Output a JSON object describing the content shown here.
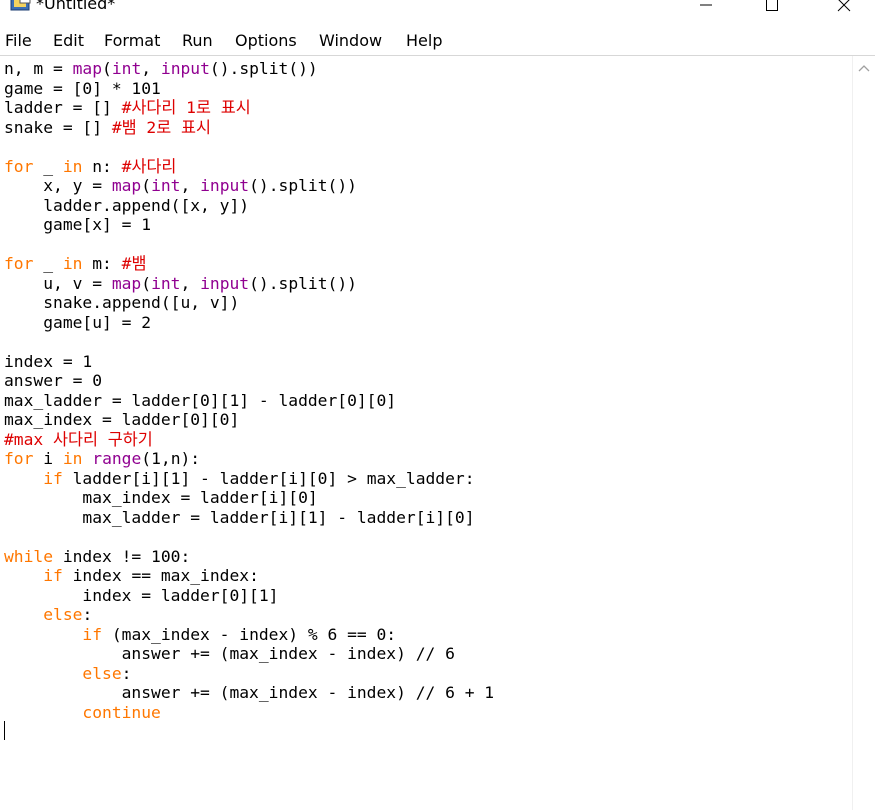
{
  "window": {
    "title": "*Untitled*"
  },
  "menu": [
    "File",
    "Edit",
    "Format",
    "Run",
    "Options",
    "Window",
    "Help"
  ],
  "code_lines": [
    [
      {
        "t": "n, m = "
      },
      {
        "t": "map",
        "c": "bi"
      },
      {
        "t": "("
      },
      {
        "t": "int",
        "c": "bi"
      },
      {
        "t": ", "
      },
      {
        "t": "input",
        "c": "bi"
      },
      {
        "t": "().split())"
      }
    ],
    [
      {
        "t": "game = [0] * 101"
      }
    ],
    [
      {
        "t": "ladder = [] "
      },
      {
        "t": "#사다리 1로 표시",
        "c": "cm"
      }
    ],
    [
      {
        "t": "snake = [] "
      },
      {
        "t": "#뱀 2로 표시",
        "c": "cm"
      }
    ],
    [
      {
        "t": ""
      }
    ],
    [
      {
        "t": "for",
        "c": "kw"
      },
      {
        "t": " _ "
      },
      {
        "t": "in",
        "c": "kw"
      },
      {
        "t": " n: "
      },
      {
        "t": "#사다리",
        "c": "cm"
      }
    ],
    [
      {
        "t": "    x, y = "
      },
      {
        "t": "map",
        "c": "bi"
      },
      {
        "t": "("
      },
      {
        "t": "int",
        "c": "bi"
      },
      {
        "t": ", "
      },
      {
        "t": "input",
        "c": "bi"
      },
      {
        "t": "().split())"
      }
    ],
    [
      {
        "t": "    ladder.append([x, y])"
      }
    ],
    [
      {
        "t": "    game[x] = 1"
      }
    ],
    [
      {
        "t": ""
      }
    ],
    [
      {
        "t": "for",
        "c": "kw"
      },
      {
        "t": " _ "
      },
      {
        "t": "in",
        "c": "kw"
      },
      {
        "t": " m: "
      },
      {
        "t": "#뱀",
        "c": "cm"
      }
    ],
    [
      {
        "t": "    u, v = "
      },
      {
        "t": "map",
        "c": "bi"
      },
      {
        "t": "("
      },
      {
        "t": "int",
        "c": "bi"
      },
      {
        "t": ", "
      },
      {
        "t": "input",
        "c": "bi"
      },
      {
        "t": "().split())"
      }
    ],
    [
      {
        "t": "    snake.append([u, v])"
      }
    ],
    [
      {
        "t": "    game[u] = 2"
      }
    ],
    [
      {
        "t": ""
      }
    ],
    [
      {
        "t": "index = 1"
      }
    ],
    [
      {
        "t": "answer = 0"
      }
    ],
    [
      {
        "t": "max_ladder = ladder[0][1] - ladder[0][0]"
      }
    ],
    [
      {
        "t": "max_index = ladder[0][0]"
      }
    ],
    [
      {
        "t": "#max 사다리 구하기",
        "c": "cm"
      }
    ],
    [
      {
        "t": "for",
        "c": "kw"
      },
      {
        "t": " i "
      },
      {
        "t": "in",
        "c": "kw"
      },
      {
        "t": " "
      },
      {
        "t": "range",
        "c": "bi"
      },
      {
        "t": "(1,n):"
      }
    ],
    [
      {
        "t": "    "
      },
      {
        "t": "if",
        "c": "kw"
      },
      {
        "t": " ladder[i][1] - ladder[i][0] > max_ladder:"
      }
    ],
    [
      {
        "t": "        max_index = ladder[i][0]"
      }
    ],
    [
      {
        "t": "        max_ladder = ladder[i][1] - ladder[i][0]"
      }
    ],
    [
      {
        "t": ""
      }
    ],
    [
      {
        "t": "while",
        "c": "kw"
      },
      {
        "t": " index != 100:"
      }
    ],
    [
      {
        "t": "    "
      },
      {
        "t": "if",
        "c": "kw"
      },
      {
        "t": " index == max_index:"
      }
    ],
    [
      {
        "t": "        index = ladder[0][1]"
      }
    ],
    [
      {
        "t": "    "
      },
      {
        "t": "else",
        "c": "kw"
      },
      {
        "t": ":"
      }
    ],
    [
      {
        "t": "        "
      },
      {
        "t": "if",
        "c": "kw"
      },
      {
        "t": " (max_index - index) % 6 == 0:"
      }
    ],
    [
      {
        "t": "            answer += (max_index - index) // 6"
      }
    ],
    [
      {
        "t": "        "
      },
      {
        "t": "else",
        "c": "kw"
      },
      {
        "t": ":"
      }
    ],
    [
      {
        "t": "            answer += (max_index - index) // 6 + 1"
      }
    ],
    [
      {
        "t": "        "
      },
      {
        "t": "continue",
        "c": "kw"
      }
    ]
  ],
  "colors": {
    "keyword": "#ff7700",
    "builtin": "#900090",
    "comment": "#dd0000",
    "text": "#000000"
  }
}
